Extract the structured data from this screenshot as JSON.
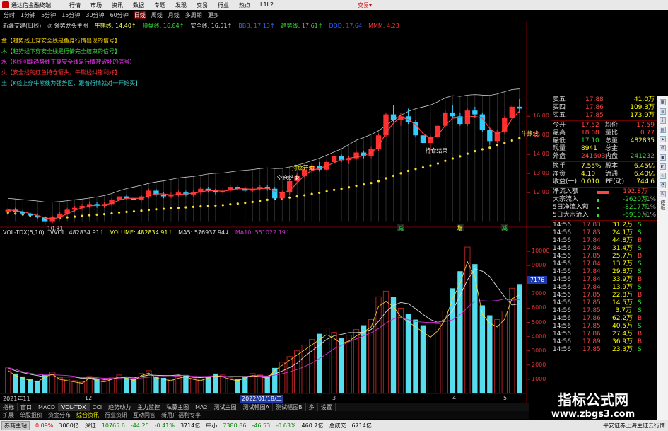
{
  "app": {
    "title": "通达信金融终端",
    "menu": [
      "行情",
      "市场",
      "资讯",
      "数据",
      "专题",
      "发现",
      "交易",
      "行业",
      "热点",
      "L1L2"
    ],
    "trade_label": "交易▾"
  },
  "periods": {
    "items": [
      "分时",
      "1分钟",
      "5分钟",
      "15分钟",
      "30分钟",
      "60分钟",
      "日线",
      "周线",
      "月线",
      "多周期",
      "更多"
    ],
    "active": "日线"
  },
  "indicator_line": [
    {
      "text": "新疆交建(日线)",
      "color": "#dddddd"
    },
    {
      "text": "◎ 领势龙头主图",
      "color": "#dddddd"
    },
    {
      "text": "牛熊线: 14.40↑",
      "color": "#ffff66"
    },
    {
      "text": "操盘线: 16.84↑",
      "color": "#33dd33"
    },
    {
      "text": "安全线: 16.51↑",
      "color": "#dddddd"
    },
    {
      "text": "BBB: 17.13↑",
      "color": "#3366ff"
    },
    {
      "text": "趋势线: 17.61↑",
      "color": "#33dd33"
    },
    {
      "text": "DDD: 17.64",
      "color": "#3366ff"
    },
    {
      "text": "MMM: 4.23",
      "color": "#ff3333"
    }
  ],
  "tips": [
    {
      "text": "金【趋势线上穿安全线是鱼身行情出现的信号】",
      "color": "#ffd700"
    },
    {
      "text": "木【趋势线下穿安全线是行情完全结束的信号】",
      "color": "#44dd44"
    },
    {
      "text": "水【K线回踩趋势线下穿安全线是行情被破坏的信号】",
      "color": "#ff33ff"
    },
    {
      "text": "火【安全线的红色持仓箭头，牛熊线纠错利好】",
      "color": "#ff3333"
    },
    {
      "text": "土【K线上穿牛熊线为强势区，跟着行情就对一开始买】",
      "color": "#33cccc"
    }
  ],
  "chart_data": [
    {
      "type": "candlestick",
      "title": "新疆交建(日线)",
      "ylim": [
        10.3,
        16.9
      ],
      "yticks": [
        16.0,
        15.0,
        14.0,
        13.0,
        12.0
      ],
      "ohlc": [
        [
          11.0,
          11.2,
          10.8,
          11.1
        ],
        [
          11.1,
          11.2,
          10.9,
          11.0
        ],
        [
          11.0,
          11.1,
          10.8,
          10.9
        ],
        [
          10.9,
          11.0,
          10.7,
          10.8
        ],
        [
          10.8,
          10.9,
          10.6,
          10.7
        ],
        [
          10.7,
          10.8,
          10.31,
          10.5
        ],
        [
          10.5,
          10.8,
          10.4,
          10.7
        ],
        [
          10.7,
          11.0,
          10.6,
          10.9
        ],
        [
          10.9,
          11.2,
          10.8,
          11.1
        ],
        [
          11.1,
          11.3,
          11.0,
          11.2
        ],
        [
          11.2,
          11.4,
          11.1,
          11.3
        ],
        [
          11.3,
          11.5,
          11.2,
          11.4
        ],
        [
          11.4,
          11.5,
          11.2,
          11.3
        ],
        [
          11.3,
          11.5,
          11.2,
          11.4
        ],
        [
          11.4,
          11.7,
          11.3,
          11.6
        ],
        [
          11.6,
          11.9,
          11.5,
          11.8
        ],
        [
          11.8,
          11.9,
          11.6,
          11.7
        ],
        [
          11.7,
          11.8,
          11.5,
          11.6
        ],
        [
          11.6,
          11.9,
          11.5,
          11.8
        ],
        [
          11.8,
          12.2,
          11.7,
          12.1
        ],
        [
          12.1,
          12.2,
          11.8,
          11.9
        ],
        [
          11.9,
          12.0,
          11.7,
          11.8
        ],
        [
          11.8,
          12.0,
          11.7,
          11.9
        ],
        [
          11.9,
          12.1,
          11.8,
          12.0
        ],
        [
          12.0,
          12.1,
          11.8,
          11.9
        ],
        [
          11.9,
          12.1,
          11.8,
          12.0
        ],
        [
          12.0,
          12.3,
          11.9,
          12.2
        ],
        [
          12.2,
          12.3,
          12.0,
          12.1
        ],
        [
          12.1,
          12.2,
          11.9,
          12.0
        ],
        [
          12.0,
          12.2,
          11.9,
          12.1
        ],
        [
          12.1,
          12.4,
          12.0,
          12.3
        ],
        [
          12.3,
          12.4,
          12.1,
          12.2
        ],
        [
          12.2,
          12.3,
          12.0,
          12.1
        ],
        [
          12.1,
          12.3,
          12.0,
          12.2
        ],
        [
          12.2,
          12.4,
          12.1,
          12.3
        ],
        [
          12.3,
          12.4,
          12.1,
          12.2
        ],
        [
          12.2,
          12.3,
          11.6,
          11.7
        ],
        [
          11.7,
          12.1,
          11.6,
          12.0
        ],
        [
          12.0,
          12.7,
          11.9,
          12.6
        ],
        [
          12.6,
          13.0,
          12.5,
          12.9
        ],
        [
          12.9,
          13.3,
          12.8,
          13.2
        ],
        [
          13.2,
          13.5,
          13.0,
          13.4
        ],
        [
          13.4,
          13.6,
          13.1,
          13.2
        ],
        [
          13.2,
          13.7,
          13.1,
          13.6
        ],
        [
          13.6,
          14.0,
          13.5,
          13.9
        ],
        [
          13.9,
          14.0,
          13.6,
          13.7
        ],
        [
          13.7,
          13.9,
          13.5,
          13.8
        ],
        [
          13.8,
          14.2,
          13.7,
          14.1
        ],
        [
          14.1,
          14.2,
          13.8,
          13.9
        ],
        [
          13.9,
          14.4,
          13.8,
          14.3
        ],
        [
          14.3,
          15.1,
          14.2,
          15.0
        ],
        [
          15.0,
          16.2,
          14.9,
          16.1
        ],
        [
          16.1,
          16.6,
          15.7,
          15.8
        ],
        [
          15.8,
          16.2,
          15.5,
          16.0
        ],
        [
          16.0,
          16.4,
          15.6,
          15.7
        ],
        [
          15.7,
          15.8,
          14.9,
          15.0
        ],
        [
          15.0,
          15.2,
          14.4,
          14.6
        ],
        [
          14.6,
          15.0,
          14.2,
          14.9
        ],
        [
          14.9,
          15.6,
          14.8,
          15.5
        ],
        [
          15.5,
          16.3,
          15.4,
          16.2
        ],
        [
          16.2,
          16.6,
          15.9,
          16.0
        ],
        [
          16.0,
          16.2,
          15.5,
          15.6
        ],
        [
          15.6,
          16.4,
          15.5,
          16.3
        ],
        [
          16.3,
          16.5,
          15.9,
          16.1
        ],
        [
          16.1,
          16.2,
          15.2,
          15.3
        ],
        [
          15.3,
          15.4,
          14.5,
          14.7
        ],
        [
          14.7,
          15.3,
          14.6,
          15.2
        ],
        [
          15.2,
          16.0,
          15.1,
          15.9
        ],
        [
          15.9,
          16.6,
          15.8,
          16.5
        ],
        [
          16.5,
          16.9,
          16.2,
          16.4
        ]
      ],
      "annotations": [
        {
          "text": "10.31",
          "color": "#dddddd"
        },
        {
          "text": "持仓开始",
          "color": "#ffff33"
        },
        {
          "text": "空仓结束",
          "color": "#ffffff"
        },
        {
          "text": "持仓结束",
          "color": "#ffffff"
        },
        {
          "text": "牛熊线",
          "color": "#ffff66"
        }
      ],
      "markers": [
        {
          "text": "减",
          "color": "#33dd33"
        },
        {
          "text": "增",
          "color": "#ffff33"
        },
        {
          "text": "减",
          "color": "#33dd33"
        }
      ]
    },
    {
      "type": "bar",
      "title": "VOL-TDX(5,10)",
      "ylim": [
        0,
        11000
      ],
      "yticks": [
        10000,
        9000,
        8000,
        7000,
        6000,
        5000,
        4000,
        3000,
        2000,
        1000
      ],
      "series": [
        {
          "name": "VOLUME",
          "values": [
            1800,
            1400,
            1200,
            1000,
            900,
            1300,
            1500,
            1100,
            1000,
            900,
            800,
            1200,
            1000,
            900,
            1100,
            1300,
            1200,
            1000,
            1400,
            1600,
            1200,
            1100,
            1000,
            1200,
            1300,
            1100,
            1000,
            1200,
            1400,
            1300,
            1100,
            1000,
            1200,
            1400,
            1300,
            1200,
            1800,
            2200,
            2600,
            3000,
            3400,
            3800,
            4200,
            4600,
            4300,
            3900,
            4100,
            4500,
            4800,
            5200,
            6800,
            7200,
            6800,
            6000,
            5600,
            5200,
            4800,
            4400,
            4900,
            5800,
            7400,
            8600,
            10300,
            9100,
            6200,
            5500,
            5200,
            5800,
            7400,
            7700
          ]
        },
        {
          "name": "MA5",
          "values": [
            1800,
            1600,
            1470,
            1350,
            1260,
            1160,
            1180,
            1160,
            1160,
            1160,
            1060,
            1100,
            1040,
            980,
            1000,
            1100,
            1140,
            1100,
            1200,
            1300,
            1280,
            1260,
            1260,
            1300,
            1240,
            1140,
            1120,
            1160,
            1200,
            1200,
            1200,
            1200,
            1200,
            1240,
            1240,
            1220,
            1380,
            1580,
            1820,
            2120,
            2600,
            3000,
            3400,
            3800,
            4060,
            4160,
            4280,
            4280,
            4320,
            4500,
            5080,
            5740,
            6200,
            6400,
            6320,
            5960,
            5560,
            5200,
            5000,
            5220,
            5860,
            6880,
            8000,
            8760,
            8600,
            8220,
            7500,
            6800,
            6220,
            6320
          ]
        },
        {
          "name": "MA10",
          "values": [
            1800,
            1700,
            1530,
            1420,
            1340,
            1300,
            1310,
            1290,
            1260,
            1210,
            1110,
            1140,
            1110,
            1070,
            1080,
            1080,
            1120,
            1070,
            1090,
            1150,
            1190,
            1190,
            1180,
            1250,
            1270,
            1210,
            1190,
            1210,
            1250,
            1220,
            1170,
            1160,
            1180,
            1220,
            1220,
            1210,
            1290,
            1390,
            1530,
            1680,
            1890,
            2140,
            2450,
            2790,
            3150,
            3380,
            3640,
            3840,
            4060,
            4280,
            4570,
            4960,
            5240,
            5360,
            5190,
            5060,
            5020,
            4990,
            5020,
            5070,
            5180,
            5540,
            6040,
            6500,
            6520,
            6490,
            6540,
            6640,
            6570,
            6590
          ]
        }
      ]
    }
  ],
  "vol_header": [
    {
      "text": "VOL-TDX(5,10)",
      "color": "#dddddd"
    },
    {
      "text": "VVOL: 482834.91↑",
      "color": "#dddddd"
    },
    {
      "text": "VOLUME: 482834.91↑",
      "color": "#ffff33"
    },
    {
      "text": "MA5: 576937.94↓",
      "color": "#dddddd"
    },
    {
      "text": "MA10: 551022.19↑",
      "color": "#cc33cc"
    }
  ],
  "cursor_value": "7176",
  "date_axis": {
    "year": "2021年11",
    "marks": [
      "12",
      "2022/01/18/二",
      "3",
      "4",
      "5"
    ]
  },
  "tabs1": {
    "items": [
      "指标",
      "窗口",
      "MACD",
      "VOL-TDX",
      "CCI",
      "趋势动力",
      "主力监控",
      "私募主图",
      "MA2",
      "测试主图",
      "测试幅图A",
      "测试幅图B",
      "多",
      "设置"
    ],
    "active": "VOL-TDX"
  },
  "tabs2": {
    "items": [
      "扩展",
      "单股报价",
      "资金分布",
      "综合资讯",
      "行业资讯",
      "互动问答",
      "新用户福利专享"
    ],
    "active": "综合资讯"
  },
  "quote": {
    "asks": [
      {
        "label": "卖五",
        "price": "17.88",
        "vol": "41.0万"
      },
      {
        "label": "买四",
        "price": "17.86",
        "vol": "109.3万"
      },
      {
        "label": "买五",
        "price": "17.85",
        "vol": "173.9万"
      }
    ],
    "stats": [
      {
        "k1": "今开",
        "v1": "17.52",
        "c1": "#ff4444",
        "k2": "均价",
        "v2": "17.59",
        "c2": "#ff4444"
      },
      {
        "k1": "最高",
        "v1": "18.08",
        "c1": "#ff4444",
        "k2": "量比",
        "v2": "0.77",
        "c2": "#ff4444"
      },
      {
        "k1": "最低",
        "v1": "17.10",
        "c1": "#33dd33",
        "k2": "总量",
        "v2": "482835",
        "c2": "#ffff33"
      },
      {
        "k1": "现量",
        "v1": "8941",
        "c1": "#ffff33",
        "k2": "总金",
        "v2": "",
        "c2": "#ffff33"
      },
      {
        "k1": "外盘",
        "v1": "241603",
        "c1": "#ff4444",
        "k2": "内盘",
        "v2": "241232",
        "c2": "#33dd33"
      }
    ],
    "stats2": [
      {
        "k1": "换手",
        "v1": "7.55%",
        "c1": "#ffff33",
        "k2": "股本",
        "v2": "6.45亿",
        "c2": "#ffff33"
      },
      {
        "k1": "净资",
        "v1": "4.10",
        "c1": "#ffff33",
        "k2": "流通",
        "v2": "6.40亿",
        "c2": "#ffff33"
      },
      {
        "k1": "收益(一)",
        "v1": "0.010",
        "c1": "#ffff33",
        "k2": "PE(动)",
        "v2": "744.6",
        "c2": "#ffff33"
      }
    ],
    "flows": [
      {
        "k": "净流入额",
        "v": "192.8万",
        "color": "#ff4444",
        "u": "",
        "bar": 60,
        "barColor": "#ff4444"
      },
      {
        "k": "大宗流入",
        "v": "-2620万",
        "color": "#33dd33",
        "u": "-1%",
        "bar": 10,
        "barColor": "#33dd33"
      },
      {
        "k": "5日净流入额",
        "v": "-8217万",
        "color": "#33dd33",
        "u": "-1%",
        "bar": 14,
        "barColor": "#33dd33"
      },
      {
        "k": "5日大宗流入",
        "v": "-6910万",
        "color": "#33dd33",
        "u": "-1%",
        "bar": 12,
        "barColor": "#33dd33"
      }
    ],
    "ticks": [
      {
        "t": "14:56",
        "p": "17.83",
        "v": "31.2万",
        "s": "S",
        "pc": "#ff4444",
        "sc": "#33dd33"
      },
      {
        "t": "14:56",
        "p": "17.83",
        "v": "24.1万",
        "s": "S",
        "pc": "#ff4444",
        "sc": "#33dd33"
      },
      {
        "t": "14:56",
        "p": "17.84",
        "v": "44.8万",
        "s": "B",
        "pc": "#ff4444",
        "sc": "#ff4444"
      },
      {
        "t": "14:56",
        "p": "17.84",
        "v": "31.4万",
        "s": "S",
        "pc": "#ff4444",
        "sc": "#33dd33"
      },
      {
        "t": "14:56",
        "p": "17.85",
        "v": "25.7万",
        "s": "B",
        "pc": "#ff4444",
        "sc": "#ff4444"
      },
      {
        "t": "14:56",
        "p": "17.84",
        "v": "13.7万",
        "s": "S",
        "pc": "#ff4444",
        "sc": "#33dd33"
      },
      {
        "t": "14:56",
        "p": "17.84",
        "v": "29.8万",
        "s": "S",
        "pc": "#ff4444",
        "sc": "#33dd33"
      },
      {
        "t": "14:56",
        "p": "17.84",
        "v": "33.9万",
        "s": "B",
        "pc": "#ff4444",
        "sc": "#ff4444"
      },
      {
        "t": "14:56",
        "p": "17.84",
        "v": "13.9万",
        "s": "S",
        "pc": "#ff4444",
        "sc": "#33dd33"
      },
      {
        "t": "14:56",
        "p": "17.85",
        "v": "22.8万",
        "s": "B",
        "pc": "#ff4444",
        "sc": "#ff4444"
      },
      {
        "t": "14:56",
        "p": "17.85",
        "v": "14.5万",
        "s": "S",
        "pc": "#ff4444",
        "sc": "#33dd33"
      },
      {
        "t": "14:56",
        "p": "17.85",
        "v": "3.7万",
        "s": "S",
        "pc": "#ff4444",
        "sc": "#33dd33"
      },
      {
        "t": "14:56",
        "p": "17.86",
        "v": "62.2万",
        "s": "B",
        "pc": "#ff4444",
        "sc": "#ff4444"
      },
      {
        "t": "14:56",
        "p": "17.85",
        "v": "40.5万",
        "s": "S",
        "pc": "#ff4444",
        "sc": "#33dd33"
      },
      {
        "t": "14:56",
        "p": "17.86",
        "v": "27.4万",
        "s": "B",
        "pc": "#ff4444",
        "sc": "#ff4444"
      },
      {
        "t": "14:56",
        "p": "17.89",
        "v": "36.9万",
        "s": "B",
        "pc": "#ff4444",
        "sc": "#ff4444"
      },
      {
        "t": "14:56",
        "p": "17.85",
        "v": "23.3万",
        "s": "S",
        "pc": "#ff4444",
        "sc": "#33dd33"
      }
    ]
  },
  "status": {
    "chip1": "券商主站",
    "pct1": "0.09%",
    "amt1": "3000亿",
    "sz_label": "深证",
    "sz_val": "10765.6",
    "sz_chg": "-44.25",
    "sz_pct": "-0.41%",
    "sz_amt": "3714亿",
    "zx_label": "中小",
    "zx_val": "7380.86",
    "zx_chg": "-46.53",
    "zx_pct": "-0.63%",
    "zx_amt": "460.7亿",
    "total_label": "总成交",
    "total_val": "6714亿",
    "right": "平安证券上海主证云行情"
  },
  "side_label": "模板",
  "watermark": {
    "line1": "指标公式网",
    "line2": "www.zbgs3.com"
  },
  "colors": {
    "up": "#ff3030",
    "down": "#33ccff",
    "vol_up": "#aa2222",
    "vol_down": "#55ddee",
    "ma_white": "#dddddd",
    "ma_yellow": "#ffdd33"
  }
}
